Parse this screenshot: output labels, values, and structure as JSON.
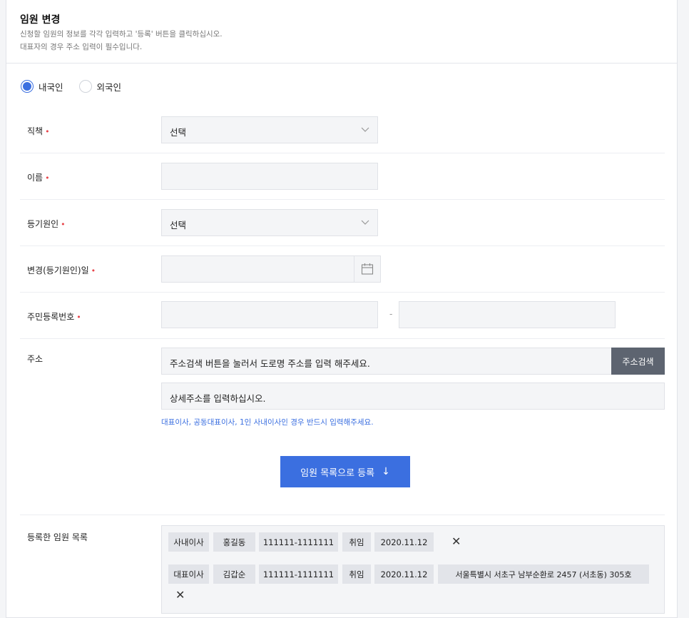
{
  "header": {
    "title": "임원 변경",
    "desc_line1": "신청할 임원의 정보를 각각 입력하고 '등록' 버튼을 클릭하십시오.",
    "desc_line2": "대표자의 경우 주소 입력이 필수입니다."
  },
  "nationality": {
    "options": [
      "내국인",
      "외국인"
    ],
    "selected": "내국인"
  },
  "form": {
    "position": {
      "label": "직책",
      "value": "선택"
    },
    "name": {
      "label": "이름",
      "value": ""
    },
    "reason": {
      "label": "등기원인",
      "value": "선택"
    },
    "change_date": {
      "label": "변경(등기원인)일",
      "value": ""
    },
    "rrn": {
      "label": "주민등록번호",
      "part1": "",
      "part2": "",
      "separator": "-"
    },
    "address": {
      "label": "주소",
      "search_placeholder": "주소검색 버튼을 눌러서 도로명 주소를 입력 해주세요.",
      "search_button": "주소검색",
      "detail_placeholder": "상세주소를 입력하십시오.",
      "note": "대표이사, 공동대표이사, 1인 사내이사인 경우 반드시 입력해주세요."
    },
    "required_mark": "•"
  },
  "register_button": {
    "label": "임원 목록으로 등록",
    "arrow": "↓"
  },
  "registered": {
    "label": "등록한 임원 목록",
    "rows": [
      {
        "cells": [
          "사내이사",
          "홍길동",
          "111111-1111111",
          "취임",
          "2020.11.12"
        ]
      },
      {
        "cells": [
          "대표이사",
          "김갑순",
          "111111-1111111",
          "취임",
          "2020.11.12",
          "서울특별시 서초구 남부순환로 2457 (서초동) 305호"
        ]
      }
    ],
    "remove_glyph": "✕"
  },
  "icons": {
    "select_arrow": "chevron-down-icon",
    "date_picker": "calendar-icon",
    "remove": "close-icon"
  },
  "colors": {
    "accent": "#3b6fe0",
    "required": "#e8454b",
    "dark_button": "#5d6470",
    "field_bg": "#f4f5f7"
  }
}
